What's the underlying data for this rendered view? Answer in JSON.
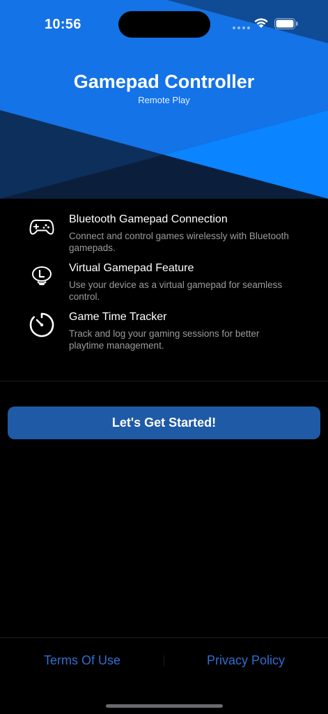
{
  "status_bar": {
    "time": "10:56"
  },
  "header": {
    "title": "Gamepad Controller",
    "subtitle": "Remote Play"
  },
  "features": [
    {
      "icon": "gamepad-icon",
      "title": "Bluetooth Gamepad Connection",
      "description": "Connect and control games wirelessly with Bluetooth gamepads."
    },
    {
      "icon": "virtual-gamepad-l-button-icon",
      "title": "Virtual Gamepad Feature",
      "description": "Use your device as a virtual gamepad for seamless control."
    },
    {
      "icon": "timer-icon",
      "title": "Game Time Tracker",
      "description": "Track and log your gaming sessions for better playtime management."
    }
  ],
  "cta": {
    "label": "Let's Get Started!"
  },
  "footer": {
    "terms": "Terms Of Use",
    "privacy": "Privacy Policy"
  },
  "colors": {
    "accent": "#0a84ff",
    "button": "#1f5aa6",
    "link": "#2f6fd0",
    "navy": "#0c2c57"
  }
}
